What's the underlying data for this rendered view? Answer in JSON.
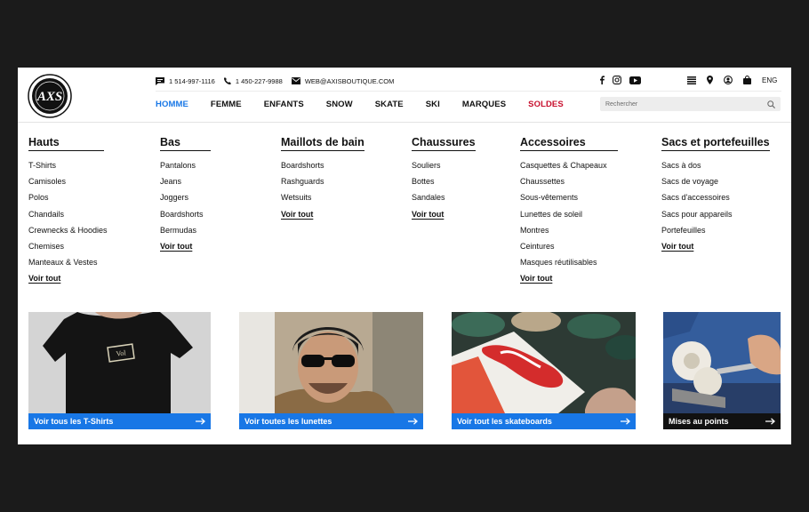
{
  "brand": {
    "logo_text": "AXS"
  },
  "contact": {
    "phone1": "1 514-997-1116",
    "phone2": "1 450-227-9988",
    "email": "WEB@AXISBOUTIQUE.COM"
  },
  "nav": {
    "items": [
      {
        "label": "HOMME"
      },
      {
        "label": "FEMME"
      },
      {
        "label": "ENFANTS"
      },
      {
        "label": "SNOW"
      },
      {
        "label": "SKATE"
      },
      {
        "label": "SKI"
      },
      {
        "label": "MARQUES"
      },
      {
        "label": "SOLDES"
      }
    ]
  },
  "search": {
    "placeholder": "Rechercher"
  },
  "utils": {
    "lang": "ENG"
  },
  "icons": {
    "social": [
      "facebook-icon",
      "instagram-icon",
      "youtube-icon"
    ],
    "utils": [
      "menu-icon",
      "location-pin-icon",
      "account-icon",
      "bag-icon"
    ]
  },
  "colors": {
    "accent": "#1877e6",
    "sale": "#c8102e",
    "card_bar": "#1877e6",
    "card_bar_dark": "#111111"
  },
  "menu": {
    "columns": [
      {
        "title": "Hauts",
        "links": [
          "T-Shirts",
          "Camisoles",
          "Polos",
          "Chandails",
          "Crewnecks & Hoodies",
          "Chemises",
          "Manteaux & Vestes"
        ],
        "voir": "Voir tout"
      },
      {
        "title": "Bas",
        "links": [
          "Pantalons",
          "Jeans",
          "Joggers",
          "Boardshorts",
          "Bermudas"
        ],
        "voir": "Voir tout"
      },
      {
        "title": "Maillots de bain",
        "links": [
          "Boardshorts",
          "Rashguards",
          "Wetsuits"
        ],
        "voir": "Voir tout"
      },
      {
        "title": "Chaussures",
        "links": [
          "Souliers",
          "Bottes",
          "Sandales"
        ],
        "voir": "Voir tout"
      },
      {
        "title": "Accessoires",
        "links": [
          "Casquettes & Chapeaux",
          "Chaussettes",
          "Sous-vêtements",
          "Lunettes de soleil",
          "Montres",
          "Ceintures",
          "Masques réutilisables"
        ],
        "voir": "Voir tout"
      },
      {
        "title": "Sacs et portefeuilles",
        "links": [
          "Sacs à dos",
          "Sacs de voyage",
          "Sacs d'accessoires",
          "Sacs pour appareils",
          "Portefeuilles"
        ],
        "voir": "Voir tout"
      }
    ]
  },
  "cards": [
    {
      "label": "Voir tous les T-Shirts"
    },
    {
      "label": "Voir toutes les lunettes"
    },
    {
      "label": "Voir tout les skateboards"
    },
    {
      "label": "Mises au points"
    }
  ]
}
